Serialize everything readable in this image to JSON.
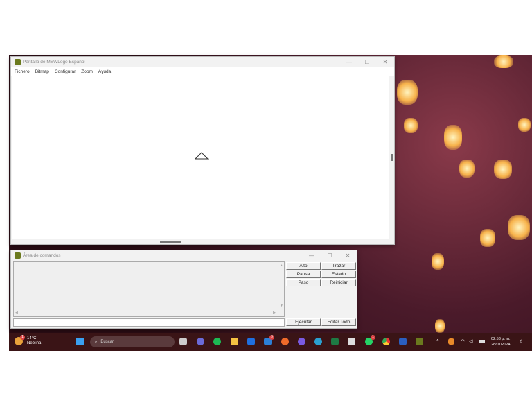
{
  "logo_window": {
    "title": "Pantalla de MSWLogo Español",
    "menu": [
      "Fichero",
      "Bitmap",
      "Configurar",
      "Zoom",
      "Ayuda"
    ],
    "controls": [
      "—",
      "☐",
      "✕"
    ]
  },
  "command_window": {
    "title": "Área de comandos",
    "controls": [
      "—",
      "☐",
      "✕"
    ],
    "buttons": {
      "alto": "Alto",
      "trazar": "Trazar",
      "pausa": "Pausa",
      "estado": "Estado",
      "paso": "Paso",
      "reiniciar": "Reiniciar",
      "ejecutar": "Ejecutar",
      "editar_todo": "Editar Todo"
    },
    "input_value": ""
  },
  "taskbar": {
    "weather_temp": "14°C",
    "weather_desc": "Neblina",
    "weather_badge": "1",
    "search_placeholder": "Buscar",
    "time": "02:53 p. m.",
    "date": "28/01/2024",
    "mail_badge": "9",
    "whatsapp_badge": "1"
  }
}
